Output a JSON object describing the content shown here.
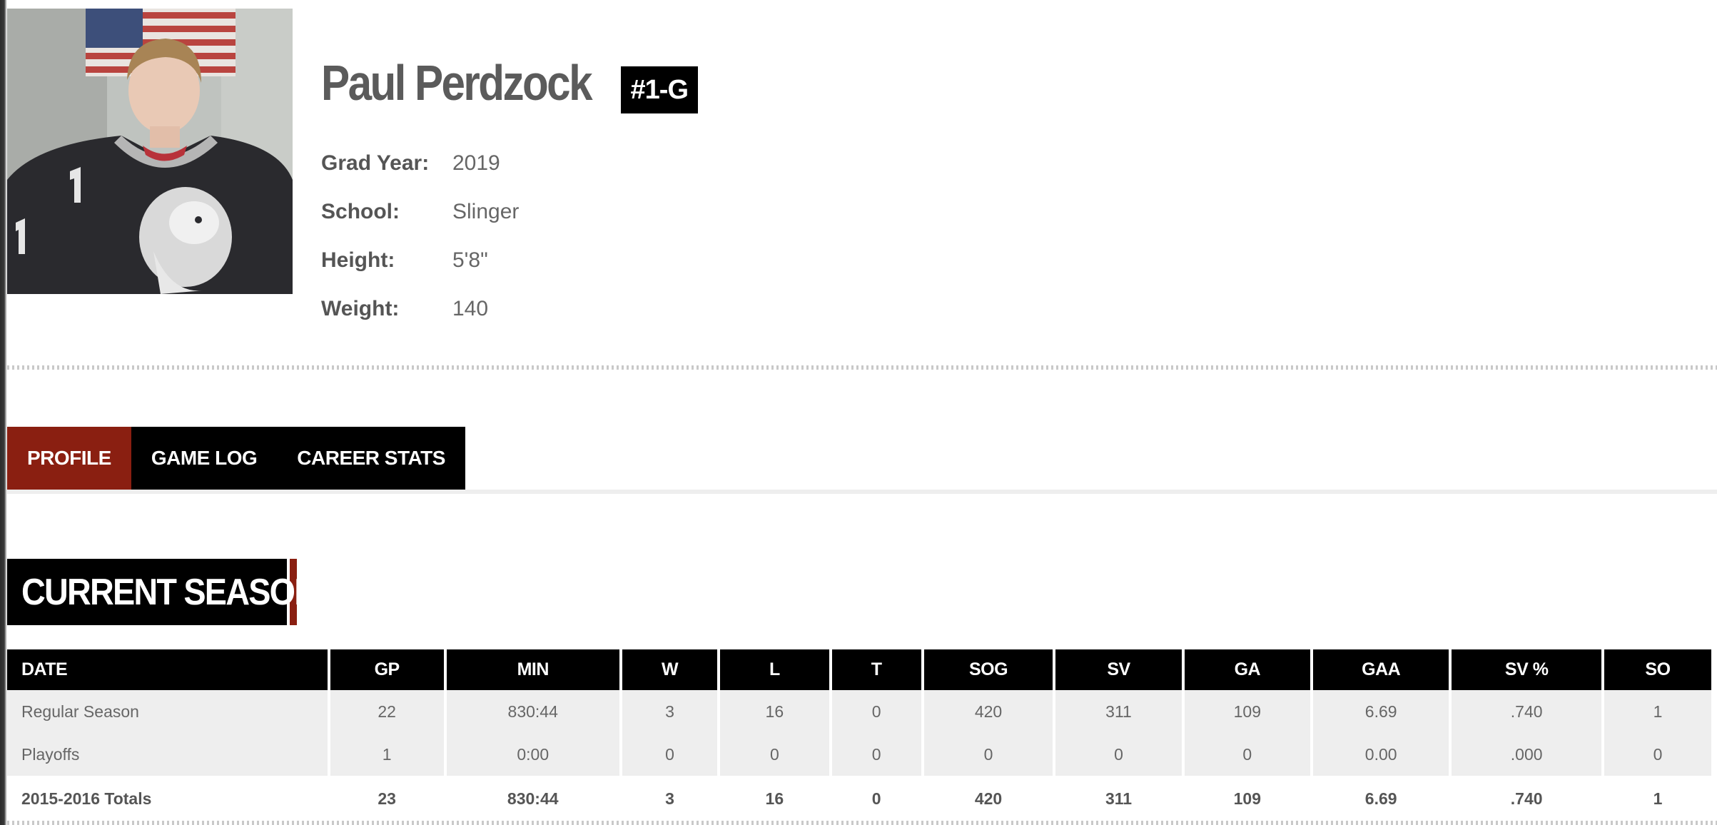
{
  "player": {
    "name": "Paul Perdzock",
    "number_badge": "#1-G",
    "info": [
      {
        "label": "Grad Year:",
        "value": "2019"
      },
      {
        "label": "School:",
        "value": "Slinger"
      },
      {
        "label": "Height:",
        "value": "5'8\""
      },
      {
        "label": "Weight:",
        "value": "140"
      }
    ]
  },
  "tabs": [
    {
      "label": "PROFILE",
      "active": true
    },
    {
      "label": "GAME LOG",
      "active": false
    },
    {
      "label": "CAREER STATS",
      "active": false
    }
  ],
  "current_season": {
    "title": "CURRENT SEASON",
    "columns": [
      "DATE",
      "GP",
      "MIN",
      "W",
      "L",
      "T",
      "SOG",
      "SV",
      "GA",
      "GAA",
      "SV %",
      "SO"
    ],
    "rows": [
      [
        "Regular Season",
        "22",
        "830:44",
        "3",
        "16",
        "0",
        "420",
        "311",
        "109",
        "6.69",
        ".740",
        "1"
      ],
      [
        "Playoffs",
        "1",
        "0:00",
        "0",
        "0",
        "0",
        "0",
        "0",
        "0",
        "0.00",
        ".000",
        "0"
      ]
    ],
    "totals": [
      "2015-2016 Totals",
      "23",
      "830:44",
      "3",
      "16",
      "0",
      "420",
      "311",
      "109",
      "6.69",
      ".740",
      "1"
    ]
  },
  "colors": {
    "accent": "#8a1f11",
    "header_bg": "#000000",
    "row_bg": "#eeeeee",
    "text": "#555555"
  }
}
